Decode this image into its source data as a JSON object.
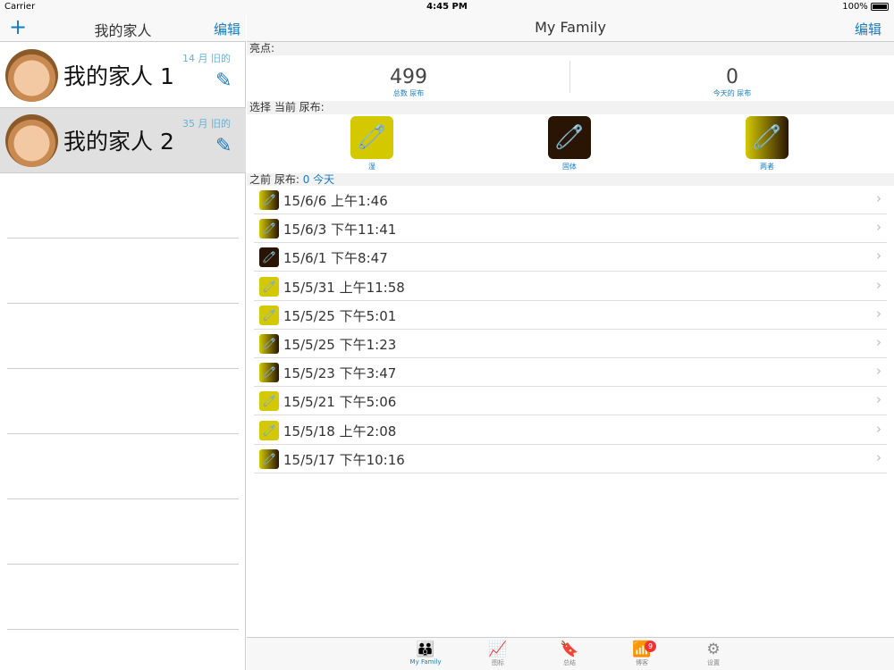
{
  "status": {
    "carrier": "Carrier",
    "time": "4:45 PM",
    "battery": "100%"
  },
  "left": {
    "title": "我的家人",
    "add": "+",
    "edit": "编辑",
    "people": [
      {
        "name": "我的家人 1",
        "age": "14 月 旧的"
      },
      {
        "name": "我的家人 2",
        "age": "35 月 旧的"
      }
    ]
  },
  "right": {
    "title": "My Family",
    "edit": "编辑",
    "highlights_label": "亮点:",
    "total": {
      "value": "499",
      "label": "总数 尿布"
    },
    "today": {
      "value": "0",
      "label": "今天的 尿布"
    },
    "select_label": "选择 当前 尿布:",
    "types": [
      {
        "label": "湿",
        "kind": "wet"
      },
      {
        "label": "固体",
        "kind": "solid"
      },
      {
        "label": "两者",
        "kind": "both"
      }
    ],
    "previous_label": "之前 尿布:",
    "previous_count": "0 今天",
    "history": [
      {
        "time": "15/6/6 上午1:46",
        "kind": "both"
      },
      {
        "time": "15/6/3 下午11:41",
        "kind": "both"
      },
      {
        "time": "15/6/1 下午8:47",
        "kind": "solid"
      },
      {
        "time": "15/5/31 上午11:58",
        "kind": "wet"
      },
      {
        "time": "15/5/25 下午5:01",
        "kind": "wet"
      },
      {
        "time": "15/5/25 下午1:23",
        "kind": "both"
      },
      {
        "time": "15/5/23 下午3:47",
        "kind": "both"
      },
      {
        "time": "15/5/21 下午5:06",
        "kind": "wet"
      },
      {
        "time": "15/5/18 上午2:08",
        "kind": "wet"
      },
      {
        "time": "15/5/17 下午10:16",
        "kind": "both"
      }
    ]
  },
  "tabs": [
    {
      "label": "My Family",
      "icon": "people-icon"
    },
    {
      "label": "图标",
      "icon": "chart-icon"
    },
    {
      "label": "总结",
      "icon": "bookmark-icon"
    },
    {
      "label": "博客",
      "icon": "rss-icon",
      "badge": "9"
    },
    {
      "label": "设置",
      "icon": "gear-icon"
    }
  ]
}
